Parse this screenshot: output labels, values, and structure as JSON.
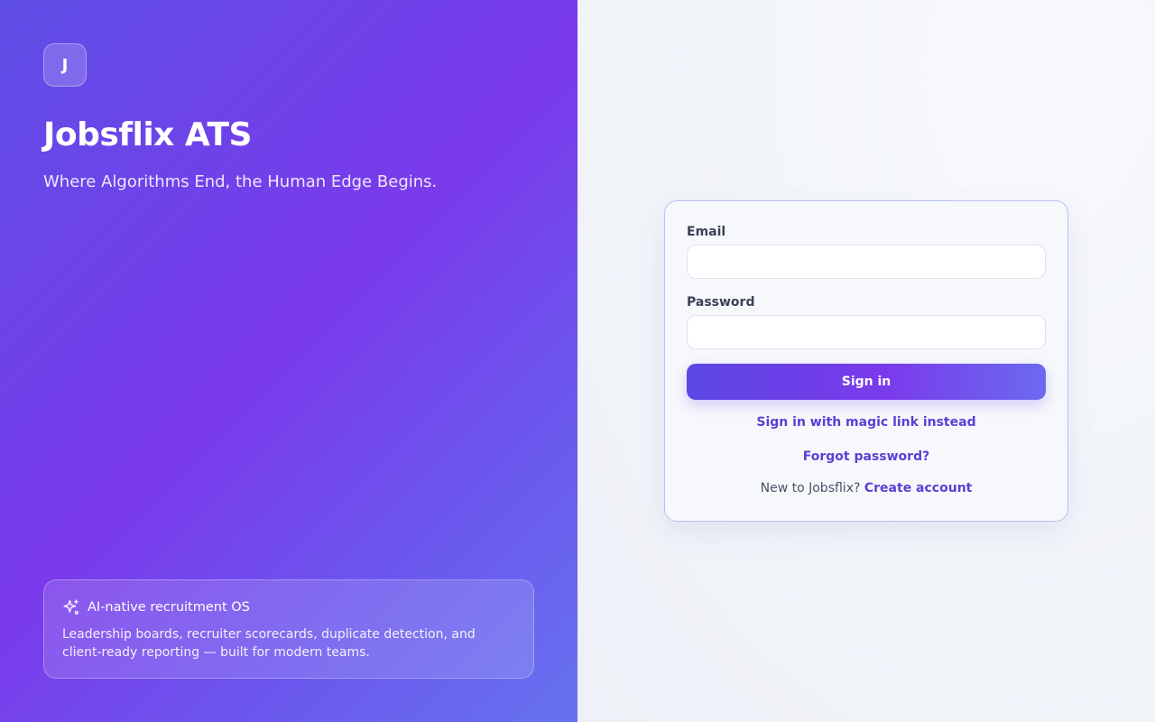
{
  "brand": {
    "logo_letter": "J",
    "title": "Jobsflix ATS",
    "tagline": "Where Algorithms End, the Human Edge Begins."
  },
  "feature": {
    "icon": "sparkles-icon",
    "title": "AI-native recruitment OS",
    "description": "Leadership boards, recruiter scorecards, duplicate detection, and client-ready reporting — built for modern teams."
  },
  "form": {
    "email_label": "Email",
    "email_value": "",
    "password_label": "Password",
    "password_value": "",
    "submit_label": "Sign in",
    "magic_link_label": "Sign in with magic link instead",
    "forgot_label": "Forgot password?",
    "new_user_text": "New to Jobsflix?",
    "create_account_label": "Create account"
  },
  "colors": {
    "accent": "#7a3aeb",
    "link": "#5b3fd6",
    "panel_gradient_start": "#5e4ee6",
    "panel_gradient_end": "#6672ef"
  }
}
